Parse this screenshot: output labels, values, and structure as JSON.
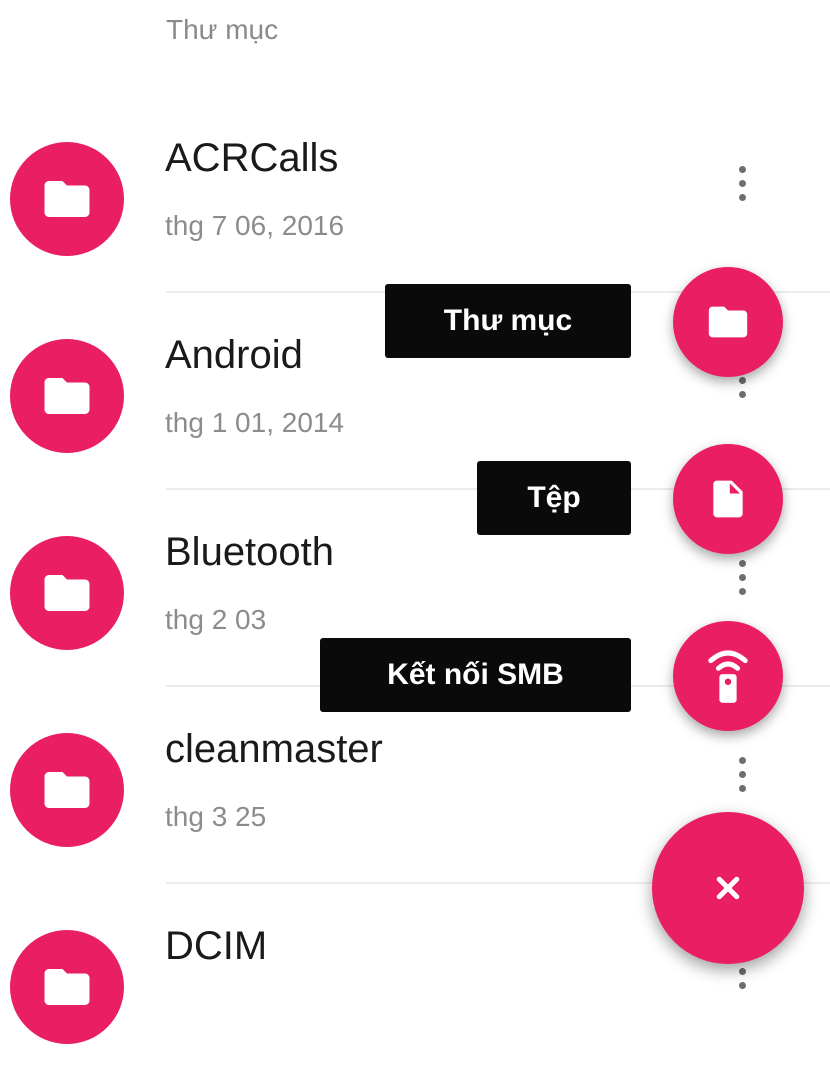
{
  "header": {
    "title": "Thư mục"
  },
  "folders": [
    {
      "name": "ACRCalls",
      "date": "thg 7 06, 2016"
    },
    {
      "name": "Android",
      "date": "thg 1 01, 2014"
    },
    {
      "name": "Bluetooth",
      "date": "thg 2 03"
    },
    {
      "name": "cleanmaster",
      "date": "thg 3 25"
    },
    {
      "name": "DCIM",
      "date": ""
    }
  ],
  "fab_menu": {
    "items": [
      {
        "label": "Thư mục",
        "icon": "folder-icon"
      },
      {
        "label": "Tệp",
        "icon": "file-icon"
      },
      {
        "label": "Kết nối SMB",
        "icon": "remote-icon"
      }
    ],
    "close_icon": "close-icon"
  },
  "colors": {
    "accent": "#e91e63",
    "label_bg": "#0a0a0a",
    "secondary_text": "#8c8c8c"
  }
}
